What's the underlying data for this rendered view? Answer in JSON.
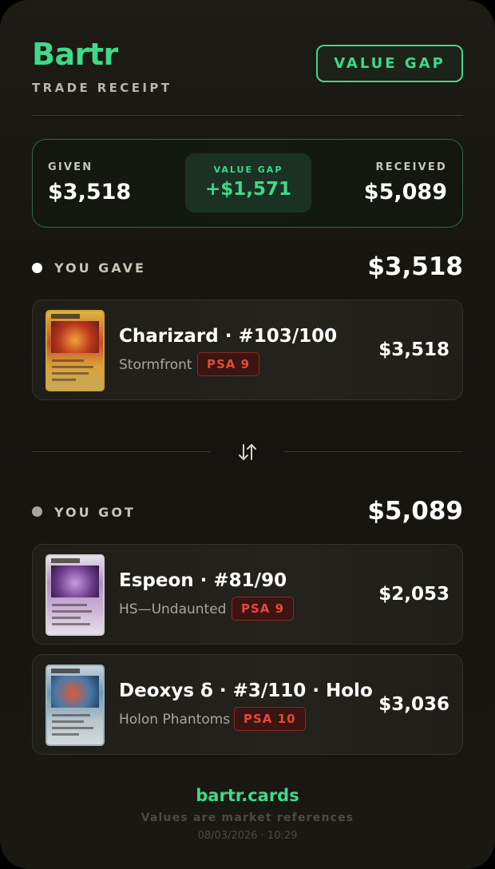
{
  "brand": {
    "name": "Bartr",
    "subtitle": "TRADE RECEIPT",
    "badge": "VALUE GAP"
  },
  "summary": {
    "given_label": "GIVEN",
    "given_value": "$3,518",
    "gap_label": "VALUE GAP",
    "gap_value": "+$1,571",
    "received_label": "RECEIVED",
    "received_value": "$5,089"
  },
  "gave": {
    "label": "YOU GAVE",
    "total": "$3,518",
    "cards": [
      {
        "name": "Charizard · #103/100",
        "set": "Stormfront",
        "grade": "PSA 9",
        "price": "$3,518"
      }
    ]
  },
  "got": {
    "label": "YOU GOT",
    "total": "$5,089",
    "cards": [
      {
        "name": "Espeon · #81/90",
        "set": "HS—Undaunted",
        "grade": "PSA 9",
        "price": "$2,053"
      },
      {
        "name": "Deoxys δ · #3/110 · Holo",
        "set": "Holon Phantoms",
        "grade": "PSA 10",
        "price": "$3,036"
      }
    ]
  },
  "footer": {
    "link": "bartr.cards",
    "note": "Values are market references",
    "datetime": "08/03/2026 · 10:29"
  },
  "icons": {
    "swap": "swap-arrows-icon"
  },
  "colors": {
    "accent": "#3fd98a",
    "grade": "#e24b3a",
    "background": "#1a1812"
  }
}
